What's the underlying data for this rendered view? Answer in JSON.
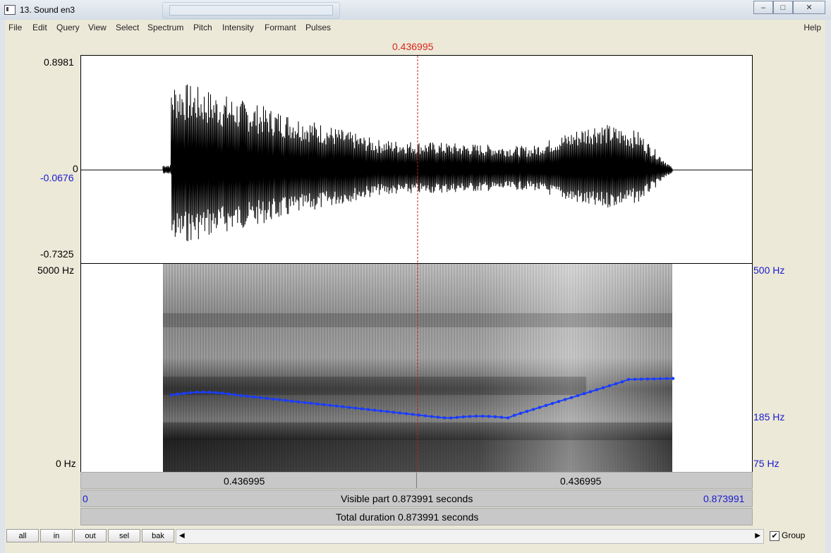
{
  "window": {
    "title": "13. Sound en3",
    "minimize": "–",
    "maximize": "□",
    "close": "✕"
  },
  "menu": [
    "File",
    "Edit",
    "Query",
    "View",
    "Select",
    "Spectrum",
    "Pitch",
    "Intensity",
    "Formant",
    "Pulses"
  ],
  "help": "Help",
  "cursor_time": "0.436995",
  "waveform": {
    "max_label": "0.8981",
    "zero_label": "0",
    "cursor_value_label": "-0.0676",
    "min_label": "-0.7325"
  },
  "spectrogram": {
    "top_label": "5000 Hz",
    "bottom_label": "0 Hz",
    "pitch_top_label": "500 Hz",
    "pitch_mid_label": "185 Hz",
    "pitch_bottom_label": "75 Hz",
    "pitch_color": "#1a3cff"
  },
  "time_bar": {
    "left_segment": "0.436995",
    "right_segment": "0.436995"
  },
  "visible_bar": {
    "start": "0",
    "text": "Visible part 0.873991 seconds",
    "end": "0.873991"
  },
  "total_bar": {
    "text": "Total duration 0.873991 seconds"
  },
  "buttons": {
    "all": "all",
    "in": "in",
    "out": "out",
    "sel": "sel",
    "bak": "bak"
  },
  "scroll": {
    "left_arrow": "◀",
    "right_arrow": "▶"
  },
  "group": {
    "label": "Group",
    "checked": true,
    "mark": "✔"
  }
}
